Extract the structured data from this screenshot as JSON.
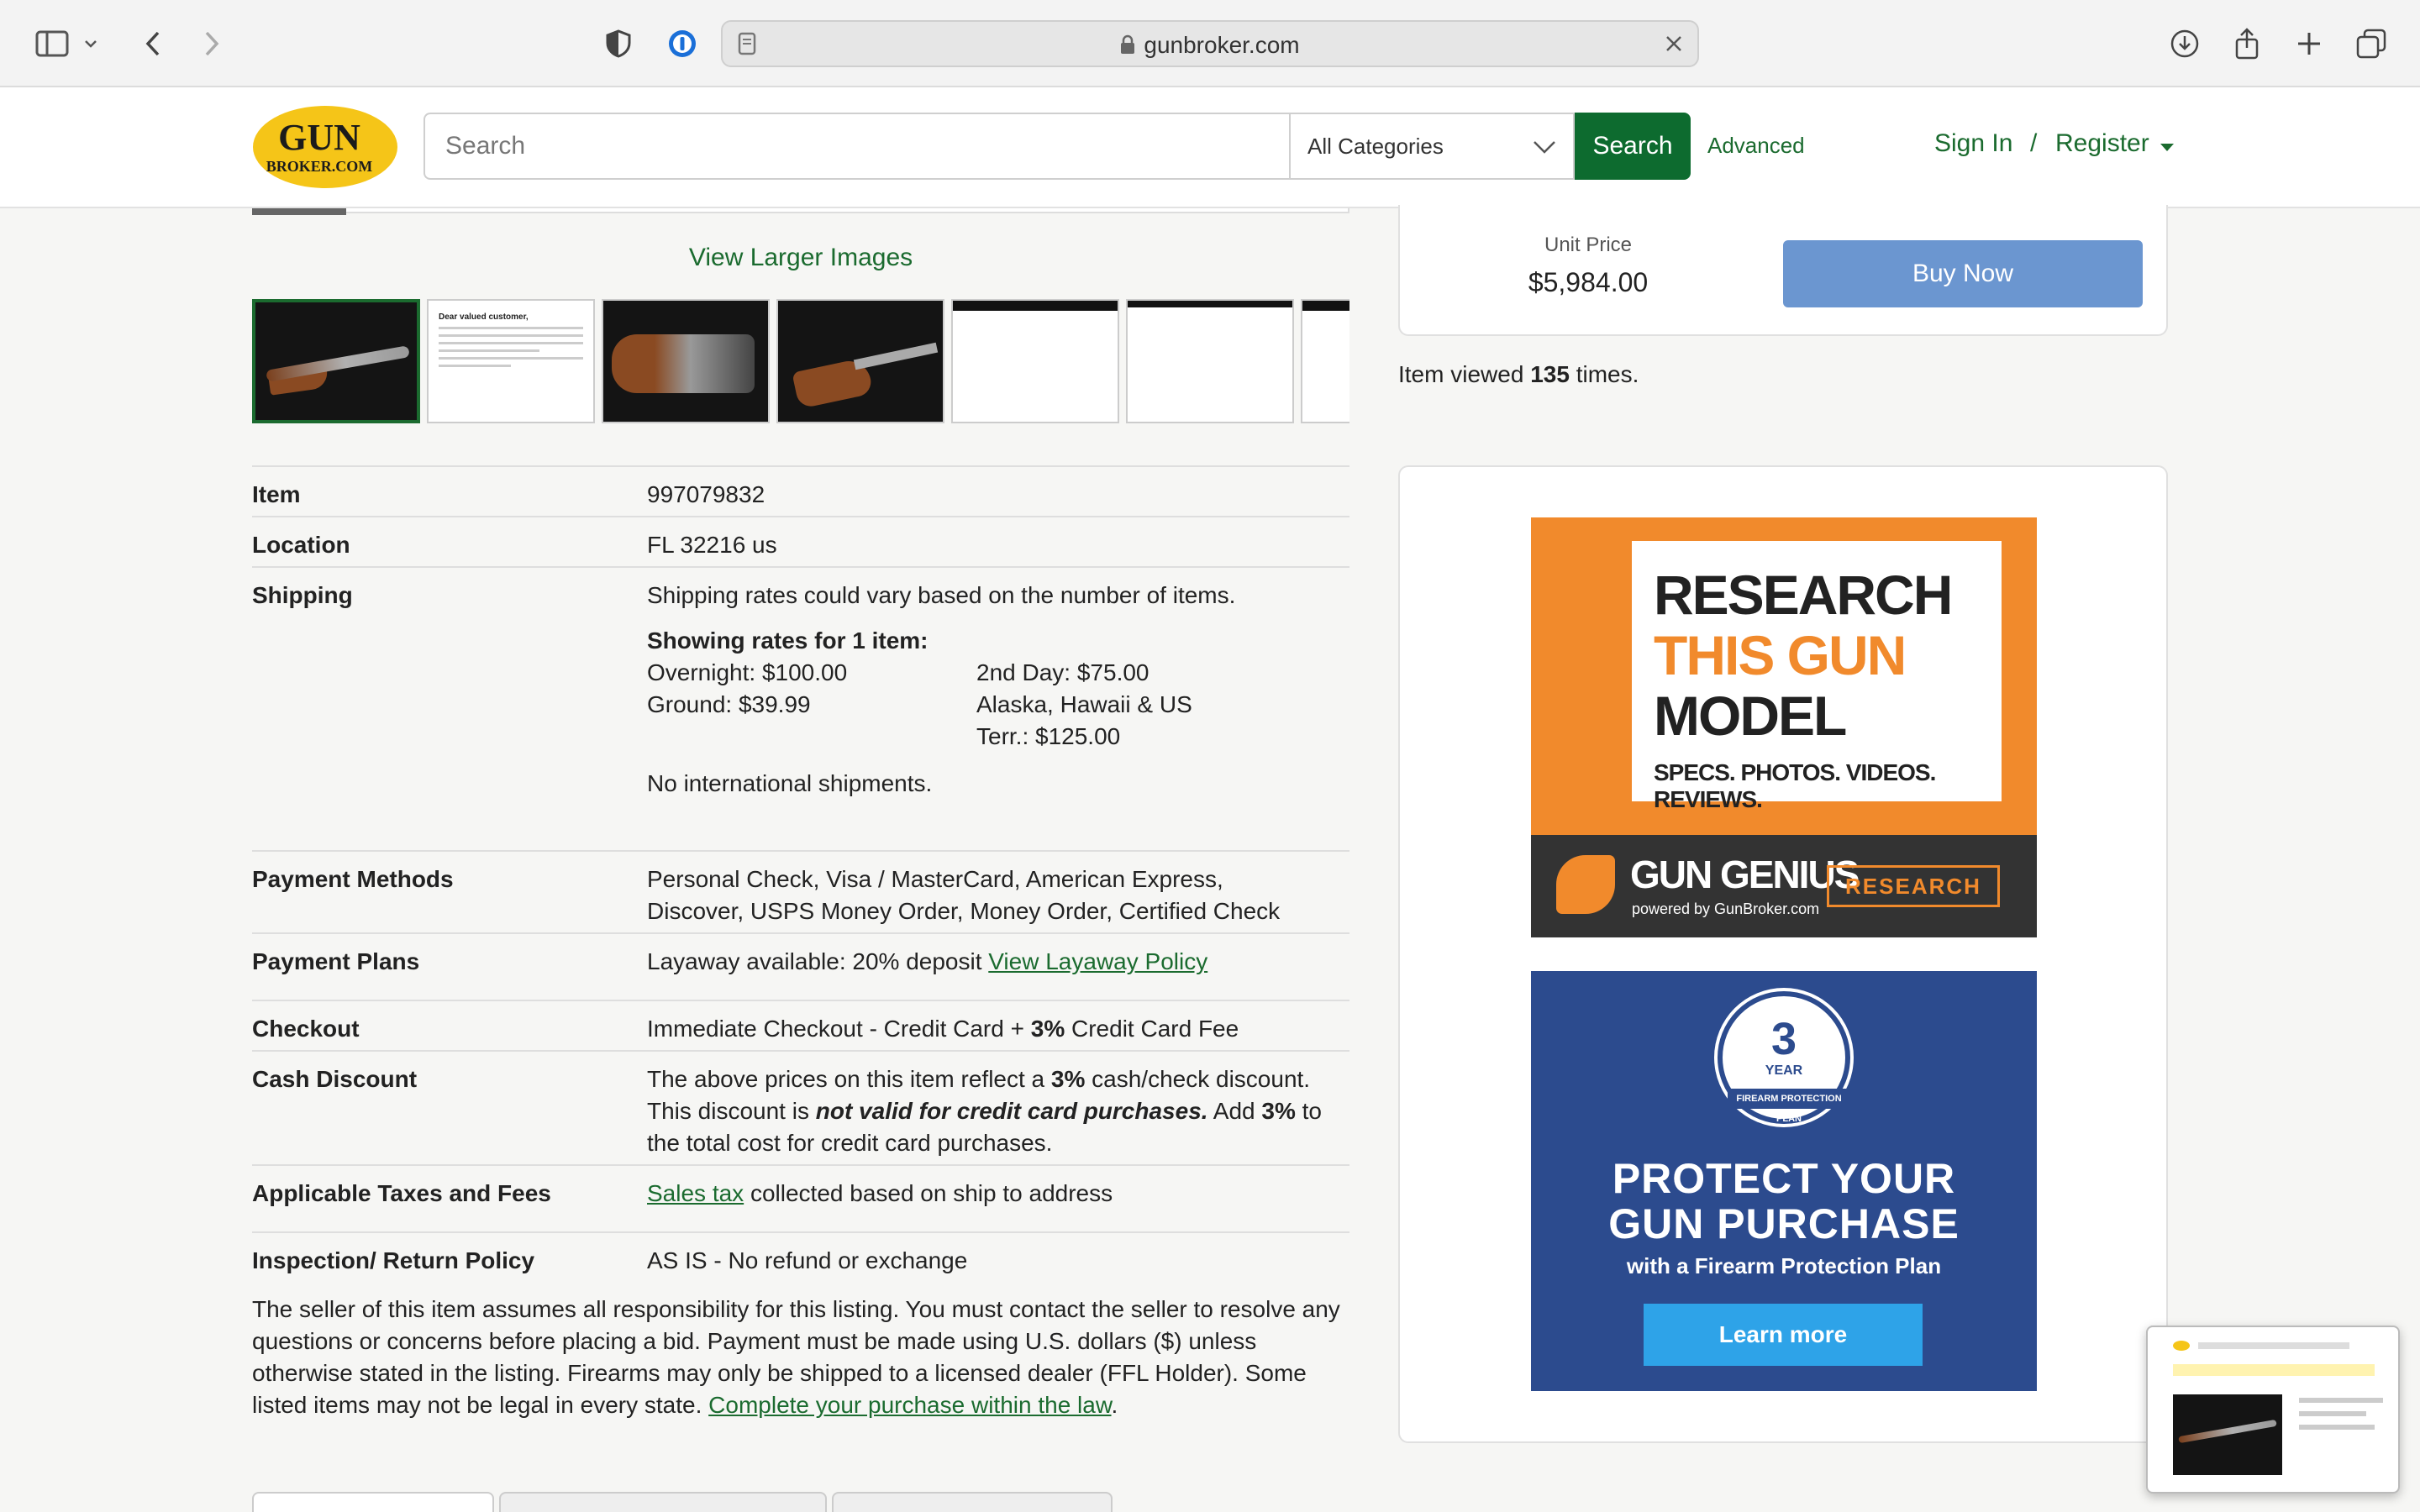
{
  "browser": {
    "url": "gunbroker.com"
  },
  "header": {
    "logo_top": "GUN",
    "logo_bottom": "BROKER.COM",
    "search_placeholder": "Search",
    "category": "All Categories",
    "search_button": "Search",
    "advanced": "Advanced",
    "sign_in": "Sign In",
    "slash": "/",
    "register": "Register"
  },
  "gallery": {
    "view_larger": "View Larger Images",
    "letter_title": "Dear valued customer,"
  },
  "details": {
    "item_label": "Item",
    "item_value": "997079832",
    "location_label": "Location",
    "location_value": "FL 32216 us",
    "shipping_label": "Shipping",
    "shipping_note": "Shipping rates could vary based on the number of items.",
    "showing_rates": "Showing rates for 1 item:",
    "rates": [
      "Overnight: $100.00",
      "2nd Day: $75.00",
      "Ground: $39.99",
      "Alaska, Hawaii & US Terr.: $125.00"
    ],
    "no_international": "No international shipments.",
    "payment_methods_label": "Payment Methods",
    "payment_methods_value": "Personal Check, Visa / MasterCard, American Express, Discover, USPS Money Order, Money Order, Certified Check",
    "payment_plans_label": "Payment Plans",
    "payment_plans_value": "Layaway available: 20% deposit",
    "layaway_link": "View Layaway Policy",
    "checkout_label": "Checkout",
    "checkout_pre": "Immediate Checkout - Credit Card +",
    "checkout_bold": "3%",
    "checkout_post": "Credit Card Fee",
    "cash_discount_label": "Cash Discount",
    "cash_1": "The above prices on this item reflect a",
    "cash_2": "3%",
    "cash_3": "cash/check discount. This discount is",
    "cash_4": "not valid for credit card purchases.",
    "cash_5": "Add",
    "cash_6": "3%",
    "cash_7": "to the total cost for credit card purchases.",
    "taxes_label": "Applicable Taxes and Fees",
    "taxes_link": "Sales tax",
    "taxes_rest": "collected based on ship to address",
    "inspection_label": "Inspection/ Return Policy",
    "inspection_value": "AS IS - No refund or exchange"
  },
  "disclaimer": {
    "text": "The seller of this item assumes all responsibility for this listing. You must contact the seller to resolve any questions or concerns before placing a bid. Payment must be made using U.S. dollars ($) unless otherwise stated in the listing. Firearms may only be shipped to a licensed dealer (FFL Holder). Some listed items may not be legal in every state.",
    "link": "Complete your purchase within the law",
    "end": "."
  },
  "buy": {
    "unit_price_label": "Unit Price",
    "unit_price": "$5,984.00",
    "buy_now": "Buy Now",
    "viewed_pre": "Item viewed",
    "viewed_count": "135",
    "viewed_post": "times."
  },
  "ads": {
    "research_line1": "RESEARCH",
    "research_line2": "THIS GUN",
    "research_line3": "MODEL",
    "research_sub": "SPECS. PHOTOS. VIDEOS. REVIEWS.",
    "gg_name": "GUN GENIUS",
    "gg_powered": "powered by GunBroker.com",
    "research_button": "RESEARCH",
    "badge_num": "3",
    "badge_year": "YEAR",
    "badge_ribbon": "FIREARM PROTECTION PLAN",
    "protect_line1": "PROTECT YOUR",
    "protect_line2": "GUN PURCHASE",
    "protect_sub": "with a Firearm Protection Plan",
    "learn_more": "Learn more"
  },
  "colors": {
    "brand_green": "#0d6b2f",
    "logo_yellow": "#f5c518",
    "buy_blue": "#6b96d0",
    "ad_orange": "#f18a2c",
    "ad_blue": "#2c4b8e"
  }
}
